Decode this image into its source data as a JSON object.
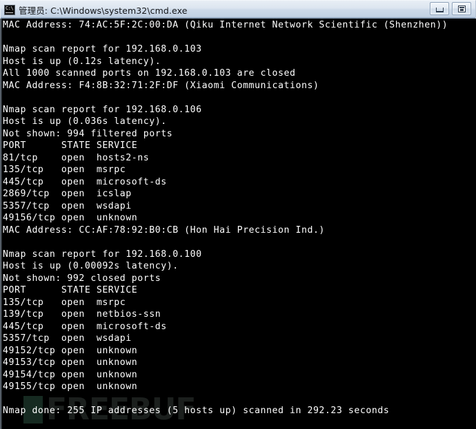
{
  "window": {
    "title": "管理员: C:\\Windows\\system32\\cmd.exe",
    "icon_name": "cmd-console-icon",
    "icon_glyph": "C:\\",
    "buttons": {
      "minimize_label": "Minimize",
      "restore_label": "Restore"
    }
  },
  "console": {
    "foreground_color": "#ffffff",
    "background_color": "#000000",
    "lines": [
      "MAC Address: 74:AC:5F:2C:00:DA (Qiku Internet Network Scientific (Shenzhen))",
      "",
      "Nmap scan report for 192.168.0.103",
      "Host is up (0.12s latency).",
      "All 1000 scanned ports on 192.168.0.103 are closed",
      "MAC Address: F4:8B:32:71:2F:DF (Xiaomi Communications)",
      "",
      "Nmap scan report for 192.168.0.106",
      "Host is up (0.036s latency).",
      "Not shown: 994 filtered ports",
      "PORT      STATE SERVICE",
      "81/tcp    open  hosts2-ns",
      "135/tcp   open  msrpc",
      "445/tcp   open  microsoft-ds",
      "2869/tcp  open  icslap",
      "5357/tcp  open  wsdapi",
      "49156/tcp open  unknown",
      "MAC Address: CC:AF:78:92:B0:CB (Hon Hai Precision Ind.)",
      "",
      "Nmap scan report for 192.168.0.100",
      "Host is up (0.00092s latency).",
      "Not shown: 992 closed ports",
      "PORT      STATE SERVICE",
      "135/tcp   open  msrpc",
      "139/tcp   open  netbios-ssn",
      "445/tcp   open  microsoft-ds",
      "5357/tcp  open  wsdapi",
      "49152/tcp open  unknown",
      "49153/tcp open  unknown",
      "49154/tcp open  unknown",
      "49155/tcp open  unknown",
      "",
      "Nmap done: 255 IP addresses (5 hosts up) scanned in 292.23 seconds"
    ]
  },
  "watermark": {
    "text": "FREEBUF",
    "block_color": "#162a21",
    "text_color": "#1b1f1d"
  }
}
